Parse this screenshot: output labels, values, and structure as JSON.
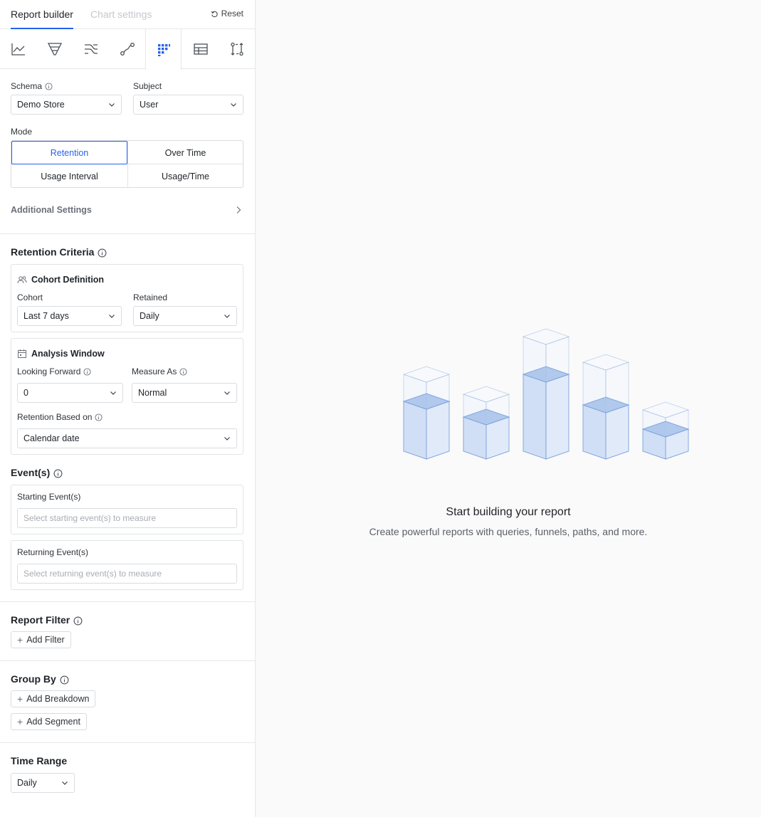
{
  "header": {
    "tab_active": "Report builder",
    "tab_inactive": "Chart settings",
    "reset_label": "Reset"
  },
  "report_types": [
    {
      "icon": "line-chart-icon"
    },
    {
      "icon": "funnel-icon"
    },
    {
      "icon": "flows-icon"
    },
    {
      "icon": "path-icon"
    },
    {
      "icon": "retention-grid-icon",
      "active": true
    },
    {
      "icon": "table-icon"
    },
    {
      "icon": "compare-icon"
    }
  ],
  "schema": {
    "label": "Schema",
    "value": "Demo Store"
  },
  "subject": {
    "label": "Subject",
    "value": "User"
  },
  "mode": {
    "label": "Mode",
    "options": [
      "Retention",
      "Over Time",
      "Usage Interval",
      "Usage/Time"
    ],
    "selected": "Retention"
  },
  "additional_settings": "Additional Settings",
  "retention_criteria": {
    "title": "Retention Criteria",
    "cohort_definition": {
      "title": "Cohort Definition",
      "cohort_label": "Cohort",
      "cohort_value": "Last 7 days",
      "retained_label": "Retained",
      "retained_value": "Daily"
    },
    "analysis_window": {
      "title": "Analysis Window",
      "looking_forward_label": "Looking Forward",
      "looking_forward_value": "0",
      "measure_as_label": "Measure As",
      "measure_as_value": "Normal",
      "based_on_label": "Retention Based on",
      "based_on_value": "Calendar date"
    }
  },
  "events": {
    "title": "Event(s)",
    "starting_label": "Starting Event(s)",
    "starting_placeholder": "Select starting event(s) to measure",
    "returning_label": "Returning Event(s)",
    "returning_placeholder": "Select returning event(s) to measure"
  },
  "report_filter": {
    "title": "Report Filter",
    "add_label": "Add Filter"
  },
  "group_by": {
    "title": "Group By",
    "add_breakdown": "Add Breakdown",
    "add_segment": "Add Segment"
  },
  "time_range": {
    "title": "Time Range",
    "value": "Daily"
  },
  "empty_state": {
    "title": "Start building your report",
    "subtitle": "Create powerful reports with queries, funnels, paths, and more."
  },
  "colors": {
    "accent": "#2563eb",
    "illustration_fill": "#dbe6f7",
    "illustration_stroke": "#7da2dc"
  }
}
